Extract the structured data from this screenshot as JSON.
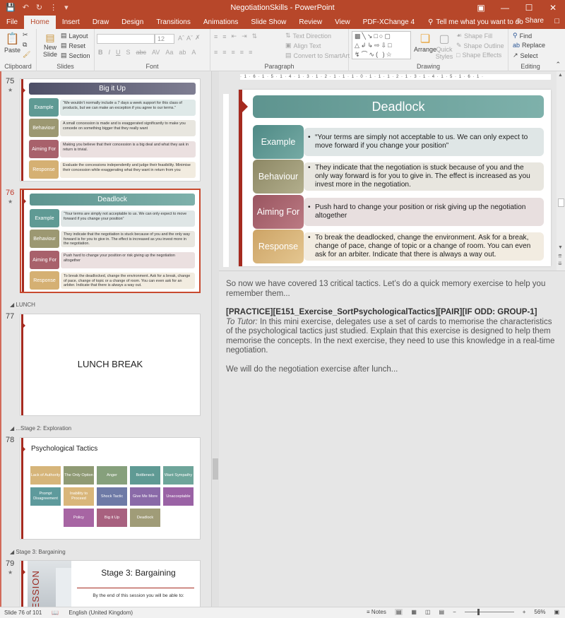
{
  "window": {
    "title": "NegotiationSkills - PowerPoint",
    "qat_icons": [
      "save-icon",
      "undo-icon",
      "redo-icon",
      "start-icon",
      "customize-icon"
    ],
    "controls": [
      "ribbon-display-icon",
      "minimize-icon",
      "maximize-icon",
      "close-icon"
    ]
  },
  "ribbon_tabs": [
    "File",
    "Home",
    "Insert",
    "Draw",
    "Design",
    "Transitions",
    "Animations",
    "Slide Show",
    "Review",
    "View",
    "PDF-XChange 4"
  ],
  "active_tab": "Home",
  "tell_me": "Tell me what you want to do",
  "share": "Share",
  "ribbon": {
    "clipboard": {
      "label": "Clipboard",
      "paste": "Paste"
    },
    "slides": {
      "label": "Slides",
      "new_slide": "New Slide",
      "layout": "Layout",
      "reset": "Reset",
      "section": "Section"
    },
    "font": {
      "label": "Font",
      "font_name": "",
      "font_size": "12"
    },
    "paragraph": {
      "label": "Paragraph",
      "text_direction": "Text Direction",
      "align_text": "Align Text",
      "convert_smartart": "Convert to SmartArt"
    },
    "drawing": {
      "label": "Drawing",
      "arrange": "Arrange",
      "quick_styles": "Quick Styles",
      "shape_fill": "Shape Fill",
      "shape_outline": "Shape Outline",
      "shape_effects": "Shape Effects"
    },
    "editing": {
      "label": "Editing",
      "find": "Find",
      "replace": "Replace",
      "select": "Select"
    }
  },
  "thumbnails": {
    "s75": {
      "num": "75",
      "title": "Big it Up",
      "rows": [
        {
          "label": "Example",
          "text": "“We wouldn’t normally include a 7 days a week support for this class of products, but we can make an exception if you agree to our terms.”"
        },
        {
          "label": "Behaviour",
          "text": "A small concession is made and is exaggerated significantly to make you concede on something bigger that they really want"
        },
        {
          "label": "Aiming For",
          "text": "Making you believe that their concession is a big deal and what they ask in return is trivial."
        },
        {
          "label": "Response",
          "text": "Evaluate the concessions independently and judge their feasibility. Minimise their concession while exaggerating what they want in return from you"
        }
      ]
    },
    "s76": {
      "num": "76",
      "title": "Deadlock",
      "rows": [
        {
          "label": "Example",
          "text": "“Your terms are simply not acceptable to us. We can only expect to move forward if you change your position”"
        },
        {
          "label": "Behaviour",
          "text": "They indicate that the negotiation is stuck because of you and the only way forward is for you to give in.  The effect is increased as you invest more in the negotiation."
        },
        {
          "label": "Aiming For",
          "text": "Push hard to change your position or risk giving up the negotiation altogether"
        },
        {
          "label": "Response",
          "text": "To break the deadlocked, change the environment. Ask for a break, change of pace, change of topic or a change of room. You can even ask for an arbiter. Indicate that there is always a way out."
        }
      ]
    },
    "section_lunch": "LUNCH",
    "s77": {
      "num": "77",
      "text": "LUNCH BREAK"
    },
    "section_exploration": "...Stage 2: Exploration",
    "s78": {
      "num": "78",
      "title": "Psychological Tactics",
      "tactics": [
        "Lack of Authority",
        "The Only Option",
        "Anger",
        "Bottleneck",
        "Want Sympathy",
        "Prompt Disagreement",
        "Inability to Proceed",
        "Shock Tactic",
        "Give Me More",
        "Unacceptable",
        "Policy",
        "Big it Up",
        "Deadlock"
      ]
    },
    "section_bargaining": "Stage 3: Bargaining",
    "s79": {
      "num": "79",
      "title": "Stage 3: Bargaining",
      "subtitle": "By the end of this session you will be able to:",
      "image_text": "SESSION"
    }
  },
  "ruler": {
    "h": "· 1 · 6 · 1 · 5 · 1 · 4 · 1 · 3 · 1 · 2 · 1 · 1 · 1 · 0 · 1 · 1 · 1 · 2 · 1 · 3 · 1 · 4 · 1 · 5 · 1 · 6 · 1 ·"
  },
  "notes": {
    "p1": "So now we have covered 13 critical tactics. Let’s do a quick memory exercise to help you remember them...",
    "p2_bold": "[PRACTICE][E151_Exercise_SortPsychologicalTactics][PAIR][IF ODD: GROUP-1]",
    "p2_italic": "To Tutor:",
    "p2_text": " In this mini exercise, delegates use a set of cards to memorise the characteristics of the psychological tactics just studied. Explain that this exercise is designed to help them memorise the concepts. In the next exercise, they need to use this knowledge in a real-time negotiation.",
    "p3": "We will do the negotiation exercise after lunch..."
  },
  "status": {
    "slide": "Slide 76 of 101",
    "language": "English (United Kingdom)",
    "notes": "Notes",
    "zoom": "56%"
  },
  "colors": {
    "accent": "#b7472a",
    "example": "#5f9a94",
    "behaviour": "#9c9872",
    "aiming": "#a8616b",
    "response": "#d5b073"
  }
}
